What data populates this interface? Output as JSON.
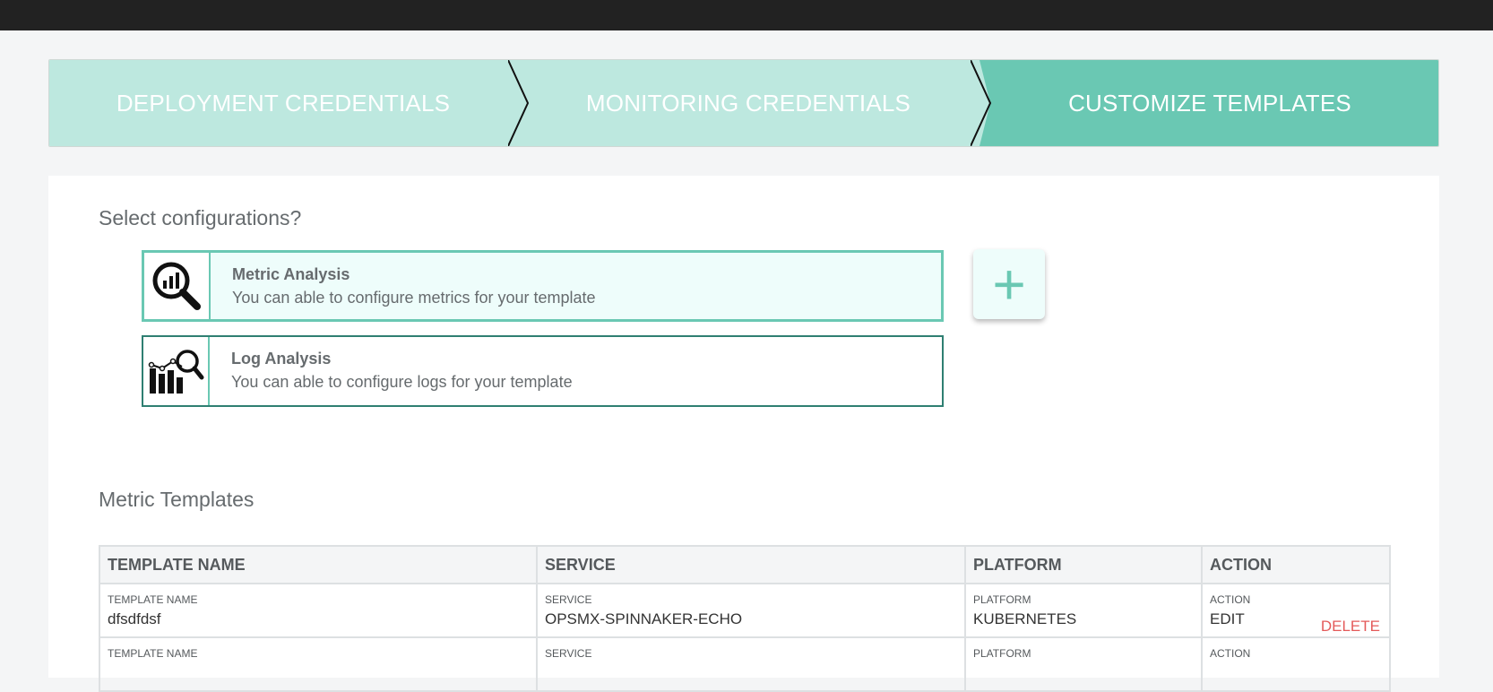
{
  "stepper": {
    "steps": [
      {
        "label": "DEPLOYMENT CREDENTIALS"
      },
      {
        "label": "MONITORING CREDENTIALS"
      },
      {
        "label": "CUSTOMIZE TEMPLATES"
      }
    ],
    "active_step": 3,
    "colors": {
      "inactive": "#bde8df",
      "active": "#6ac8b3"
    }
  },
  "select_heading": "Select configurations?",
  "options": [
    {
      "icon": "metric-analysis-icon",
      "title": "Metric Analysis",
      "description": "You can able to configure metrics for your template",
      "selected": true
    },
    {
      "icon": "log-analysis-icon",
      "title": "Log Analysis",
      "description": "You can able to configure logs for your template",
      "selected": false
    }
  ],
  "add_button": {
    "icon": "plus-icon",
    "glyph": "+"
  },
  "templates_heading": "Metric Templates",
  "table": {
    "headers": [
      "TEMPLATE NAME",
      "SERVICE",
      "PLATFORM",
      "ACTION"
    ],
    "rows": [
      {
        "template_name_label": "TEMPLATE NAME",
        "template_name": "dfsdfdsf",
        "service_label": "SERVICE",
        "service": "OPSMX-SPINNAKER-ECHO",
        "platform_label": "PLATFORM",
        "platform": "KUBERNETES",
        "action_label": "ACTION",
        "edit": "EDIT",
        "delete": "DELETE"
      },
      {
        "template_name_label": "TEMPLATE NAME",
        "template_name": "",
        "service_label": "SERVICE",
        "service": "",
        "platform_label": "PLATFORM",
        "platform": "",
        "action_label": "ACTION",
        "edit": "",
        "delete": ""
      }
    ]
  }
}
